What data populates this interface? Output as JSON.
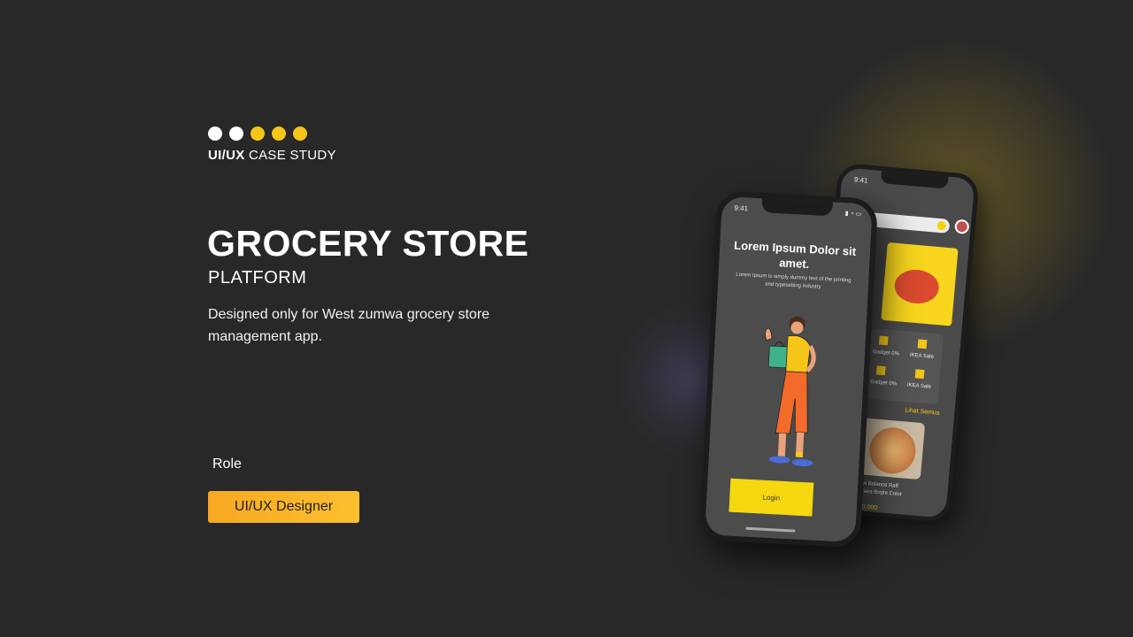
{
  "header": {
    "case_bold": "UI/UX",
    "case_text": "CASE STUDY"
  },
  "hero": {
    "title": "GROCERY STORE",
    "subtitle": "PLATFORM",
    "description": "Designed only for West zumwa grocery store management app."
  },
  "role": {
    "label": "Role",
    "value": "UI/UX Designer"
  },
  "phone_front": {
    "time": "9:41",
    "headline": "Lorem Ipsum Dolor sit amet.",
    "body": "Lorem Ipsum is simply dummy text of the printing and typesetting industry",
    "login_label": "Login"
  },
  "phone_back": {
    "time": "9:41",
    "tile_1": "Gadget 0%",
    "tile_2": "IKEA Sale",
    "tile_3": "Gadget 0%",
    "tile_4": "IKEA Sale",
    "see_all": "Lihat Semua",
    "product_name": "New Balance Raff Sonara Bright Color",
    "price": "Rp10.000"
  },
  "colors": {
    "background": "#282828",
    "accent_yellow": "#f5c518",
    "button_gradient_start": "#f7a823",
    "button_gradient_end": "#fbc02d"
  },
  "icons": {
    "dots": [
      "white",
      "white",
      "yellow",
      "yellow",
      "yellow"
    ]
  }
}
